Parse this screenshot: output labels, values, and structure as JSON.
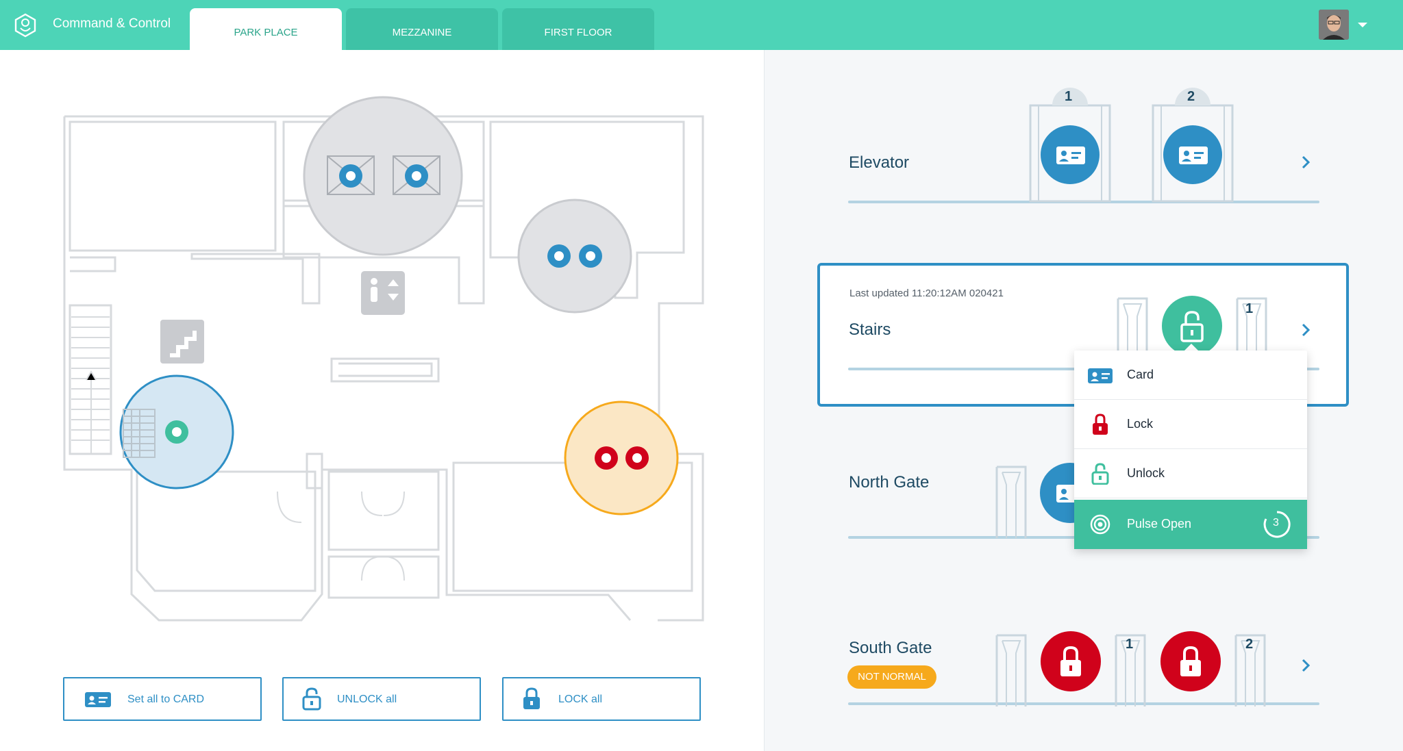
{
  "app": {
    "title": "Command & Control"
  },
  "tabs": [
    {
      "label": "PARK PLACE",
      "active": true
    },
    {
      "label": "MEZZANINE",
      "active": false
    },
    {
      "label": "FIRST FLOOR",
      "active": false
    }
  ],
  "bottom_actions": {
    "set_card": "Set all to CARD",
    "unlock_all": "UNLOCK all",
    "lock_all": "LOCK all"
  },
  "doors": {
    "elevator": {
      "title": "Elevator",
      "numbers": [
        "1",
        "2"
      ],
      "icons": [
        "card-icon",
        "card-icon"
      ]
    },
    "stairs": {
      "title": "Stairs",
      "last_updated": "Last updated 11:20:12AM 020421",
      "numbers": [
        "1"
      ],
      "icons": [
        "unlock-icon"
      ]
    },
    "north_gate": {
      "title": "North Gate",
      "icons": [
        "card-icon"
      ]
    },
    "south_gate": {
      "title": "South Gate",
      "badge": "NOT NORMAL",
      "numbers": [
        "1",
        "2"
      ],
      "icons": [
        "lock-icon",
        "lock-icon"
      ]
    }
  },
  "menu": {
    "items": [
      {
        "label": "Card",
        "icon": "card-icon"
      },
      {
        "label": "Lock",
        "icon": "lock-icon"
      },
      {
        "label": "Unlock",
        "icon": "unlock-icon"
      },
      {
        "label": "Pulse Open",
        "icon": "pulse-icon",
        "count": "3",
        "highlighted": true
      }
    ]
  },
  "colors": {
    "brand": "#4dd4b7",
    "blue": "#2e8fc5",
    "green": "#3fbf9e",
    "red": "#d0021b",
    "orange": "#f6a91c"
  }
}
